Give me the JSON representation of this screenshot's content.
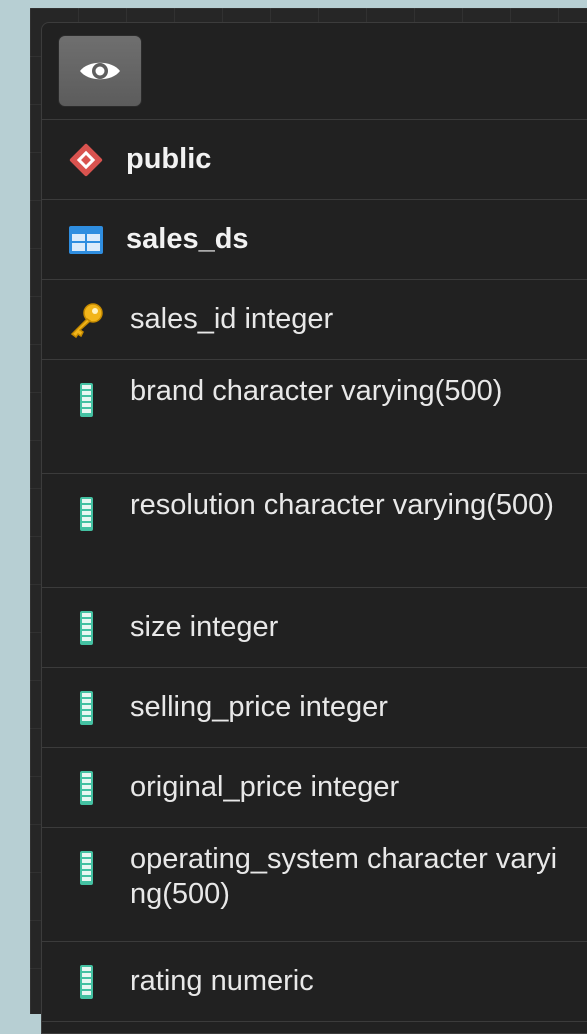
{
  "toolbar": {
    "view_icon": "eye-icon"
  },
  "tree": {
    "schema": {
      "label": "public",
      "icon": "schema-diamond-icon"
    },
    "table": {
      "label": "sales_ds",
      "icon": "table-icon"
    },
    "columns": [
      {
        "label": "sales_id integer",
        "icon": "primary-key-icon"
      },
      {
        "label": "brand character varying(500)",
        "icon": "column-icon"
      },
      {
        "label": "resolution character varying(500)",
        "icon": "column-icon"
      },
      {
        "label": "size integer",
        "icon": "column-icon"
      },
      {
        "label": "selling_price integer",
        "icon": "column-icon"
      },
      {
        "label": "original_price integer",
        "icon": "column-icon"
      },
      {
        "label": "operating_system character varying(500)",
        "icon": "column-icon"
      },
      {
        "label": "rating numeric",
        "icon": "column-icon"
      }
    ]
  },
  "colors": {
    "panel_bg": "#212121",
    "outer_bg": "#b7cfd3",
    "schema_icon": "#d9534f",
    "table_icon": "#2f8ee0",
    "key_icon": "#f2b51b",
    "column_icon": "#44c1a2"
  }
}
